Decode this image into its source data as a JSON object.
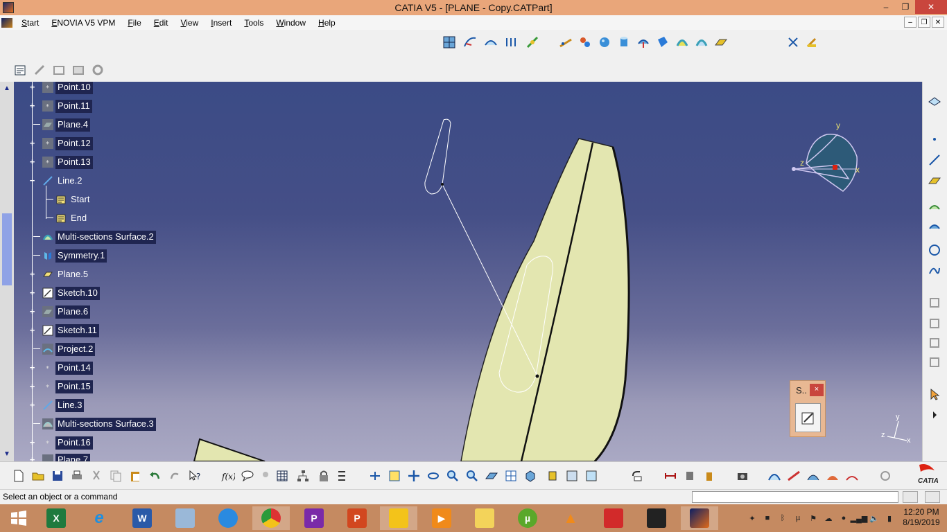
{
  "window": {
    "title": "CATIA V5 - [PLANE - Copy.CATPart]",
    "controls": {
      "minimize": "–",
      "restore": "❐",
      "close": "✕"
    }
  },
  "menubar": {
    "items": [
      "Start",
      "ENOVIA V5 VPM",
      "File",
      "Edit",
      "View",
      "Insert",
      "Tools",
      "Window",
      "Help"
    ],
    "mdi_controls": [
      "–",
      "❐",
      "✕"
    ]
  },
  "tree": {
    "nodes": [
      {
        "label": "Point.10",
        "icon": "point-icon",
        "expander": "+",
        "level": 0
      },
      {
        "label": "Point.11",
        "icon": "point-icon",
        "expander": "+",
        "level": 0
      },
      {
        "label": "Plane.4",
        "icon": "plane-icon",
        "expander": "",
        "level": 0
      },
      {
        "label": "Point.12",
        "icon": "point-icon",
        "expander": "+",
        "level": 0
      },
      {
        "label": "Point.13",
        "icon": "point-icon",
        "expander": "+",
        "level": 0
      },
      {
        "label": "Line.2",
        "icon": "line-icon",
        "expander": "−",
        "level": 0
      },
      {
        "label": "Start",
        "icon": "reference-icon",
        "expander": "",
        "level": 1
      },
      {
        "label": "End",
        "icon": "reference-icon",
        "expander": "",
        "level": 1
      },
      {
        "label": "Multi-sections Surface.2",
        "icon": "multi-sections-surface-icon",
        "expander": "",
        "level": 0
      },
      {
        "label": "Symmetry.1",
        "icon": "symmetry-icon",
        "expander": "",
        "level": 0
      },
      {
        "label": "Plane.5",
        "icon": "plane-icon",
        "expander": "+",
        "level": 0
      },
      {
        "label": "Sketch.10",
        "icon": "sketch-icon",
        "expander": "+",
        "level": 0
      },
      {
        "label": "Plane.6",
        "icon": "plane-icon",
        "expander": "+",
        "level": 0
      },
      {
        "label": "Sketch.11",
        "icon": "sketch-icon",
        "expander": "+",
        "level": 0
      },
      {
        "label": "Project.2",
        "icon": "project-icon",
        "expander": "",
        "level": 0
      },
      {
        "label": "Point.14",
        "icon": "point-icon",
        "expander": "+",
        "level": 0
      },
      {
        "label": "Point.15",
        "icon": "point-icon",
        "expander": "+",
        "level": 0
      },
      {
        "label": "Line.3",
        "icon": "line-icon",
        "expander": "+",
        "level": 0
      },
      {
        "label": "Multi-sections Surface.3",
        "icon": "multi-sections-surface-icon",
        "expander": "",
        "level": 0
      },
      {
        "label": "Point.16",
        "icon": "point-icon",
        "expander": "+",
        "level": 0
      },
      {
        "label": "Plane.7",
        "icon": "plane-icon",
        "expander": "+",
        "level": 0
      }
    ]
  },
  "compass": {
    "x": "x",
    "y": "y",
    "z": "z"
  },
  "axis_triad": {
    "x": "x",
    "y": "y",
    "z": "z"
  },
  "sketch_palette": {
    "title": "S..",
    "close": "×"
  },
  "status": {
    "message": "Select an object or a command",
    "command_input": ""
  },
  "taskbar": {
    "apps": [
      "start-button",
      "excel",
      "internet-explorer",
      "word",
      "task-manager",
      "sync",
      "chrome",
      "picsart",
      "powerpoint",
      "file-explorer",
      "media-player",
      "folder",
      "utorrent",
      "vlc",
      "reader",
      "camera-app",
      "catia"
    ],
    "clock_time": "12:20 PM",
    "clock_date": "8/19/2019"
  },
  "colors": {
    "titlebar": "#e9a67a",
    "viewport_top": "#3b4b86",
    "viewport_bottom": "#aaa9c4",
    "surface": "#e3e6b0",
    "taskbar": "#c58a61",
    "tree_label_bg": "#1f2550"
  },
  "brand": {
    "logo_text": "CATIA"
  }
}
